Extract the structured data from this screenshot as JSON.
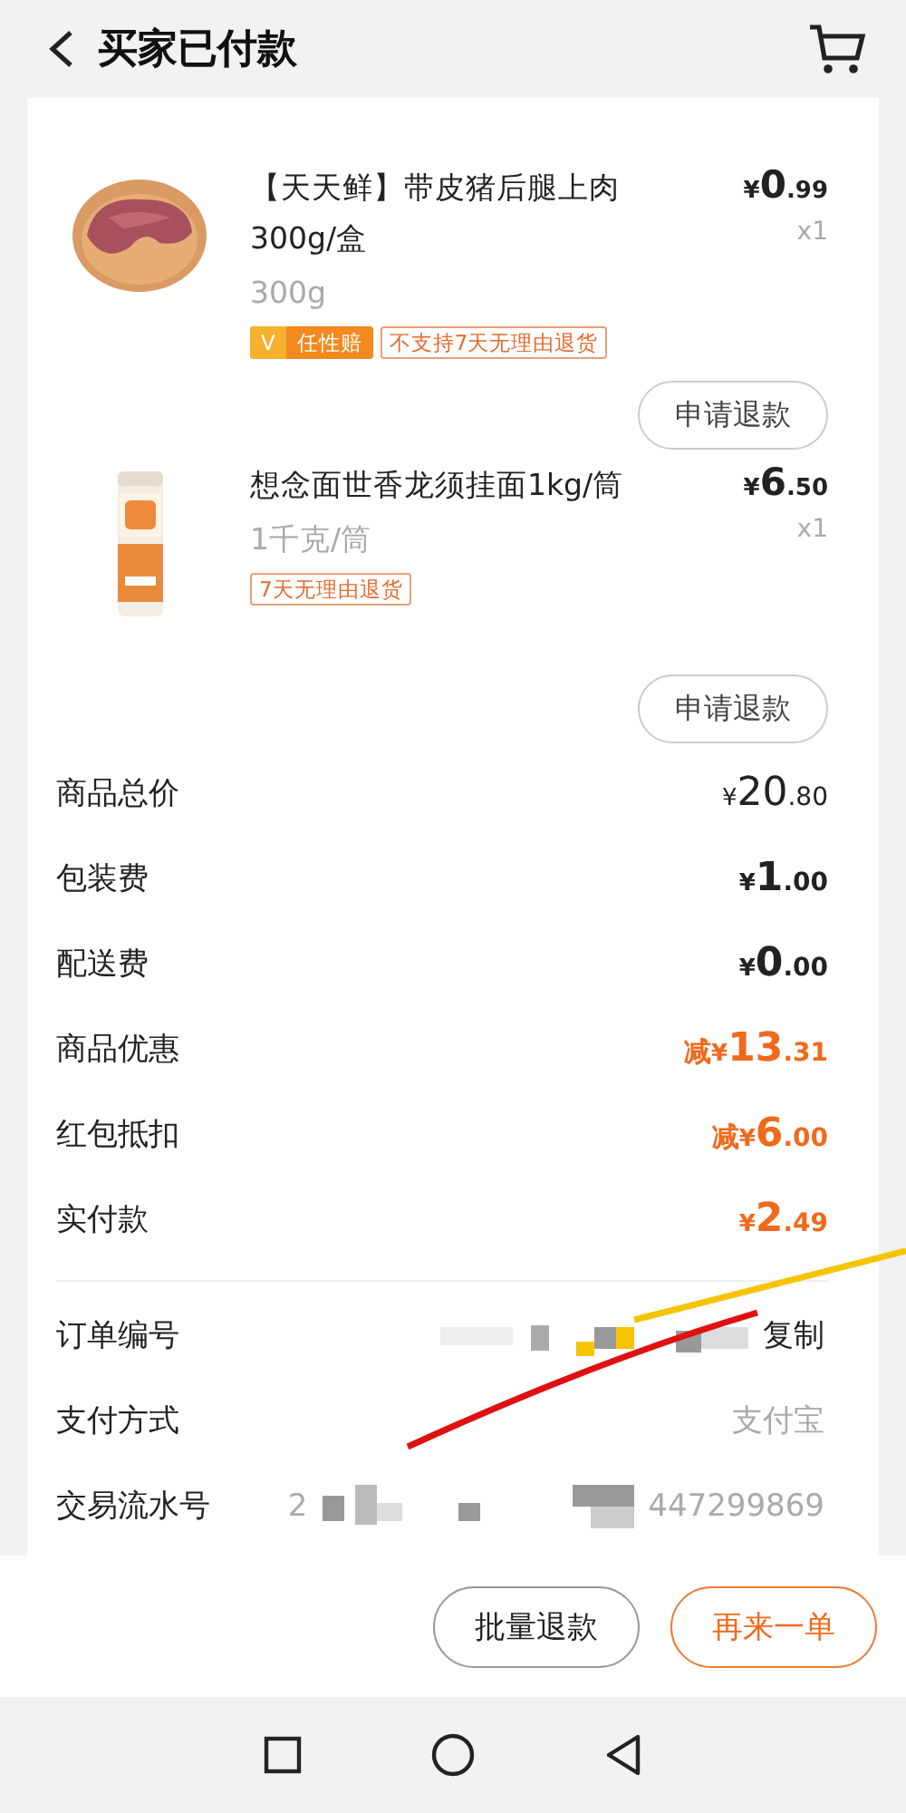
{
  "header": {
    "title": "买家已付款"
  },
  "products": [
    {
      "kind": "meat",
      "title": "【天天鲜】带皮猪后腿上肉300g/盒",
      "spec": "300g",
      "price": {
        "currency": "¥",
        "integer": "0",
        "decimal": ".99"
      },
      "quantity": "x1",
      "tags": [
        {
          "kind": "badge",
          "icon": "V",
          "text": "任性赔"
        },
        {
          "kind": "outline",
          "text": "不支持7天无理由退货"
        }
      ],
      "button": "申请退款"
    },
    {
      "kind": "noodles",
      "title": "想念面世香龙须挂面1kg/筒",
      "spec": "1千克/筒",
      "price": {
        "currency": "¥",
        "integer": "6",
        "decimal": ".50"
      },
      "quantity": "x1",
      "tags": [
        {
          "kind": "outline",
          "text": "7天无理由退货"
        }
      ],
      "button": "申请退款"
    }
  ],
  "summary": [
    {
      "kind": "subtotal",
      "label": "商品总价",
      "currency": "¥",
      "integer": "20",
      "decimal": ".80",
      "highlight": false
    },
    {
      "kind": "charge",
      "label": "包装费",
      "currency": "¥",
      "integer": "1",
      "decimal": ".00",
      "highlight": false
    },
    {
      "kind": "charge",
      "label": "配送费",
      "currency": "¥",
      "integer": "0",
      "decimal": ".00",
      "highlight": false
    },
    {
      "kind": "charge",
      "label": "商品优惠",
      "prefix": "减",
      "currency": "¥",
      "integer": "13",
      "decimal": ".31",
      "highlight": true
    },
    {
      "kind": "charge",
      "label": "红包抵扣",
      "prefix": "减",
      "currency": "¥",
      "integer": "6",
      "decimal": ".00",
      "highlight": true
    },
    {
      "kind": "charge",
      "label": "实付款",
      "currency": "¥",
      "integer": "2",
      "decimal": ".49",
      "highlight": true
    }
  ],
  "info": [
    {
      "kind": "redacted-copy",
      "label": "订单编号",
      "action": "复制"
    },
    {
      "kind": "plain",
      "label": "支付方式",
      "value": "支付宝"
    },
    {
      "kind": "redacted-tail",
      "label": "交易流水号",
      "head": "2",
      "value": "447299869"
    }
  ],
  "actions": [
    {
      "label": "批量退款",
      "primary": false
    },
    {
      "label": "再来一单",
      "primary": true
    }
  ]
}
